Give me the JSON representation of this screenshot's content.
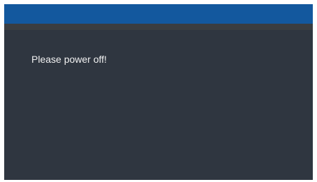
{
  "dialog": {
    "title": "",
    "message": "Please power off!"
  },
  "colors": {
    "title_bar": "#13589e",
    "title_shadow": "#3a3d41",
    "background": "#2f3640",
    "text": "#f2f2f2"
  }
}
